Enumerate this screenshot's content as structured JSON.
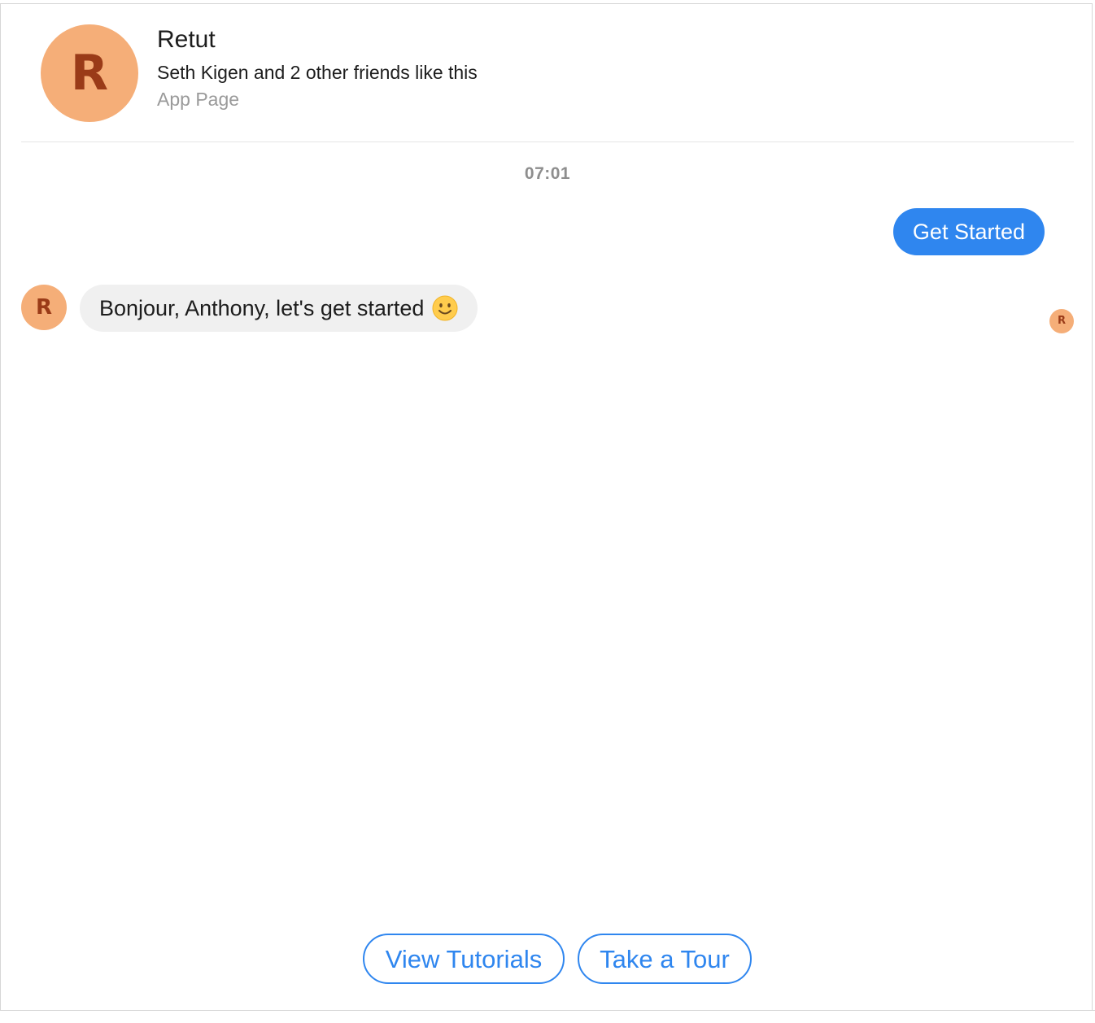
{
  "header": {
    "avatar_letter": "R",
    "page_name": "Retut",
    "likes_text": "Seth Kigen and 2 other friends like this",
    "page_type": "App Page"
  },
  "conversation": {
    "timestamp": "07:01",
    "outgoing_message": "Get Started",
    "incoming_avatar_letter": "R",
    "incoming_message": "Bonjour, Anthony, let's get started",
    "incoming_emoji": "smiley-face-icon",
    "read_receipt_letter": "R"
  },
  "quick_replies": [
    {
      "label": "View Tutorials"
    },
    {
      "label": "Take a Tour"
    }
  ],
  "colors": {
    "avatar_bg": "#f5ae78",
    "avatar_letter": "#9a3b18",
    "accent_blue": "#2f86ef",
    "incoming_bubble_bg": "#f0f0f0",
    "muted_text": "#9a9a9a"
  }
}
